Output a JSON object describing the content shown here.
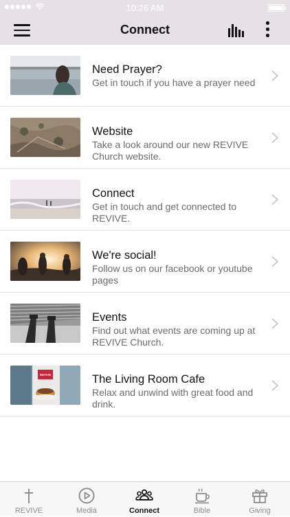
{
  "status_bar": {
    "time": "10:26 AM"
  },
  "header": {
    "title": "Connect",
    "menu_icon": "hamburger-menu-icon",
    "bars_icon": "audio-bars-icon",
    "more_icon": "more-vertical-icon"
  },
  "items": [
    {
      "title": "Need Prayer?",
      "description": "Get in touch if you have a prayer need",
      "image": "person-by-lake-photo"
    },
    {
      "title": "Website",
      "description": "Take a look around our new REVIVE Church website.",
      "image": "aerial-landscape-photo"
    },
    {
      "title": "Connect",
      "description": "Get in touch and get connected to REVIVE.",
      "image": "beach-waves-photo"
    },
    {
      "title": "We're social!",
      "description": "Follow us on our facebook or youtube pages",
      "image": "friends-at-sunset-photo"
    },
    {
      "title": "Events",
      "description": "Find out what events are coming up at REVIVE Church.",
      "image": "feet-on-rooftop-photo"
    },
    {
      "title": "The Living Room Cafe",
      "description": "Relax and unwind with great food and drink.",
      "image": "cafe-food-photo",
      "image_text": "REVIVE"
    }
  ],
  "tabs": [
    {
      "label": "REVIVE",
      "icon": "cross-icon",
      "active": false
    },
    {
      "label": "Media",
      "icon": "play-circle-icon",
      "active": false
    },
    {
      "label": "Connect",
      "icon": "people-group-icon",
      "active": true
    },
    {
      "label": "Bible",
      "icon": "coffee-cup-icon",
      "active": false
    },
    {
      "label": "Giving",
      "icon": "gift-icon",
      "active": false
    }
  ],
  "colors": {
    "header_bg": "#e6e1e4",
    "tab_active": "#111111",
    "tab_inactive": "#8e8e8e"
  }
}
